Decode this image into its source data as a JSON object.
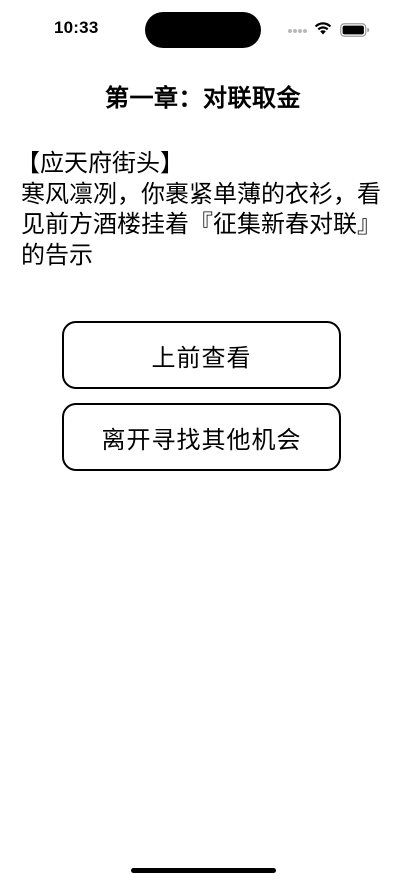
{
  "status_bar": {
    "time": "10:33",
    "icons": [
      "signal-dots-icon",
      "wifi-icon",
      "battery-icon"
    ]
  },
  "chapter": {
    "title": "第一章：对联取金"
  },
  "story": {
    "location": "【应天府街头】",
    "narration": "寒风凛冽，你裹紧单薄的衣衫，看见前方酒楼挂着『征集新春对联』的告示"
  },
  "choices": [
    {
      "label": "上前查看"
    },
    {
      "label": "离开寻找其他机会"
    }
  ],
  "colors": {
    "background": "#ffffff",
    "text": "#000000",
    "button_border": "#000000"
  }
}
